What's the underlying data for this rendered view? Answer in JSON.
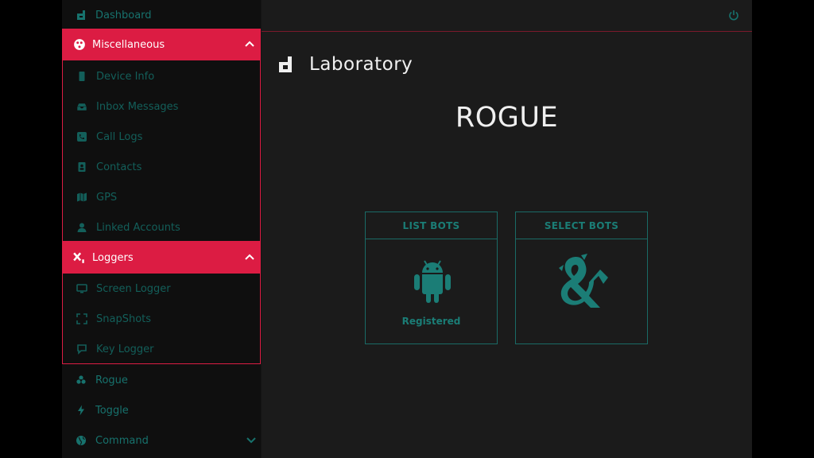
{
  "sidebar": {
    "dashboard": "Dashboard",
    "misc": {
      "label": "Miscellaneous",
      "items": [
        "Device Info",
        "Inbox Messages",
        "Call Logs",
        "Contacts",
        "GPS",
        "Linked Accounts"
      ]
    },
    "loggers": {
      "label": "Loggers",
      "items": [
        "Screen Logger",
        "SnapShots",
        "Key Logger"
      ]
    },
    "rogue": "Rogue",
    "toggle": "Toggle",
    "command": "Command"
  },
  "main": {
    "page_title": "Laboratory",
    "heading": "ROGUE",
    "cards": [
      {
        "title": "LIST BOTS",
        "caption": "Registered",
        "icon": "android-icon"
      },
      {
        "title": "SELECT BOTS",
        "icon": "dragon-ampersand-icon"
      }
    ]
  },
  "colors": {
    "accent": "#dc1c43",
    "teal": "#1a7a74",
    "panel": "#1b1b1b",
    "sidebar": "#0f0f0f"
  }
}
